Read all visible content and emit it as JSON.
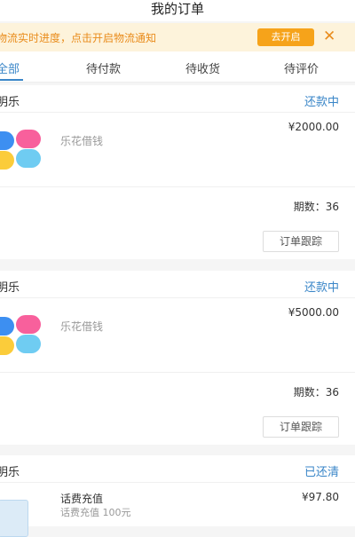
{
  "header": {
    "title": "我的订单"
  },
  "notice": {
    "text": "物流实时进度，点击开启物流通知",
    "button": "去开启",
    "close": "✕"
  },
  "tabs": [
    "全部",
    "待付款",
    "待收货",
    "待评价"
  ],
  "orders": [
    {
      "shop": "明乐",
      "status": "还款中",
      "product": "乐花借钱",
      "price": "¥2000.00",
      "periods": "期数：36",
      "action": "订单跟踪"
    },
    {
      "shop": "明乐",
      "status": "还款中",
      "product": "乐花借钱",
      "price": "¥5000.00",
      "periods": "期数：36",
      "action": "订单跟踪"
    },
    {
      "shop": "明乐",
      "status": "已还清",
      "product": "话费充值",
      "subtitle": "话费充值 100元",
      "price": "¥97.80"
    }
  ],
  "colors": {
    "accent": "#3a86c8",
    "notice_bg": "#fdf3db",
    "notice_button": "#f6a31a"
  }
}
